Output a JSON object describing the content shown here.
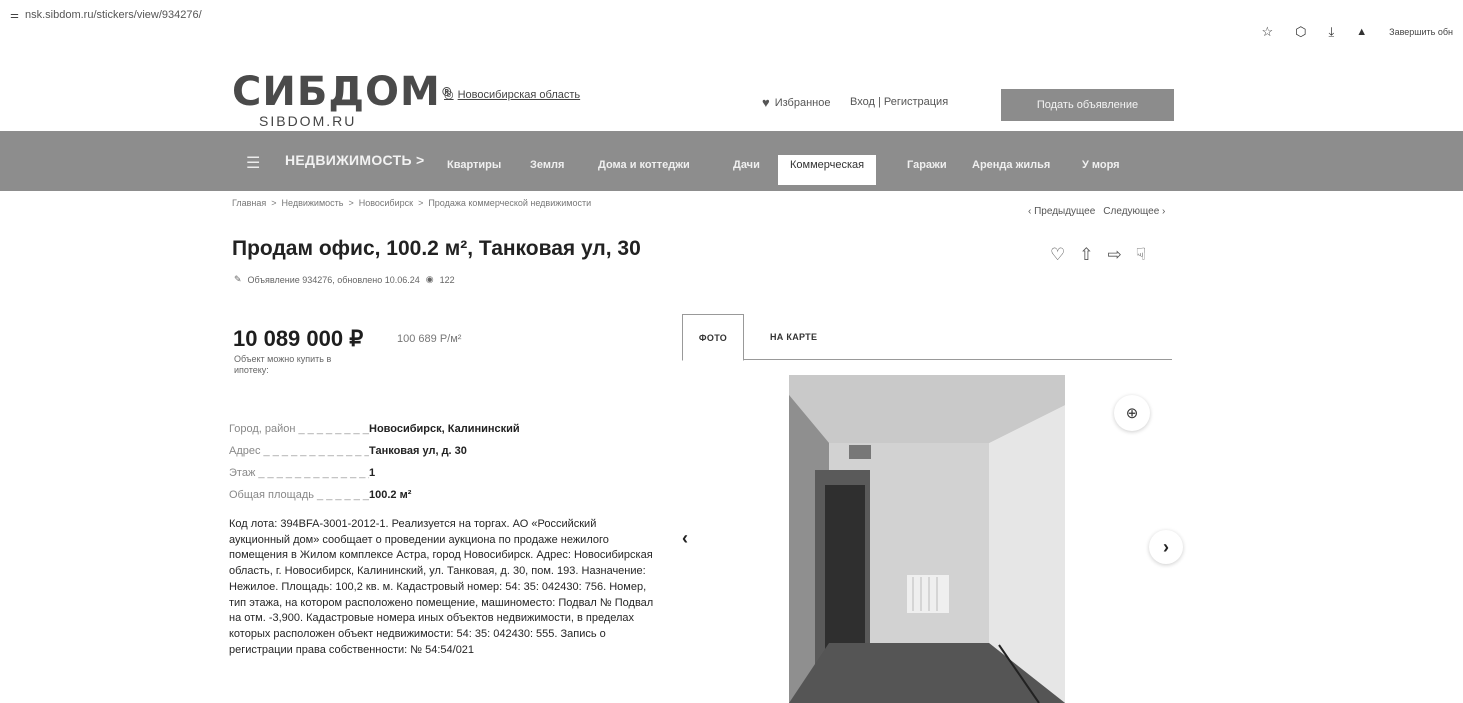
{
  "browser": {
    "url": "nsk.sibdom.ru/stickers/view/934276/",
    "star_icon": "☆",
    "extensions_icon": "⬡",
    "download_icon": "⤓",
    "profile_icon": "👤",
    "finish_setup": "Завершить обн"
  },
  "header": {
    "logo_main": "СИБДОМ",
    "logo_reg": "®",
    "logo_sub": "SIBDOM.RU",
    "region_icon": "◎",
    "region": "Новосибирская область",
    "favorites": "Избранное",
    "login": "Вход | Регистрация",
    "post_button": "Подать объявление"
  },
  "nav": {
    "title": "НЕДВИЖИМОСТЬ >",
    "items": [
      {
        "label": "Квартиры"
      },
      {
        "label": "Земля"
      },
      {
        "label": "Дома и коттеджи"
      },
      {
        "label": "Дачи"
      },
      {
        "label": "Коммерческая"
      },
      {
        "label": "Гаражи"
      },
      {
        "label": "Аренда жилья"
      },
      {
        "label": "У моря"
      }
    ],
    "active": "Коммерческая"
  },
  "breadcrumb": {
    "items": [
      "Главная",
      "Недвижимость",
      "Новосибирск",
      "Продажа коммерческой недвижимости"
    ],
    "separator": ">"
  },
  "pager": {
    "prev": "‹ Предыдущее",
    "next": "Следующее ›"
  },
  "listing": {
    "title": "Продам офис, 100.2 м², Танковая ул, 30",
    "meta": "Объявление 934276, обновлено 10.06.24",
    "views": "122",
    "price": "10 089 000 ₽",
    "price_per_sqm": "100 689 Р/м²",
    "mortgage": "Объект можно купить в ипотеку:",
    "params": [
      {
        "label": "Город, район",
        "value": "Новосибирск, Калининский"
      },
      {
        "label": "Адрес",
        "value": "Танковая ул, д. 30"
      },
      {
        "label": "Этаж",
        "value": "1"
      },
      {
        "label": "Общая площадь",
        "value": "100.2 м²"
      }
    ],
    "description": "Код лота: 394BFA-3001-2012-1. Реализуется на торгах. АО «Российский аукционный дом» сообщает о проведении аукциона по продаже нежилого помещения в Жилом комплексе Астра, город Новосибирск. Адрес: Новосибирская область, г. Новосибирск, Калининский, ул. Танковая, д. 30, пом. 193. Назначение: Нежилое. Площадь: 100,2 кв. м. Кадастровый номер: 54: 35: 042430: 756. Номер, тип этажа, на котором расположено помещение, машиноместо: Подвал № Подвал на отм. -3,900. Кадастровые номера иных объектов недвижимости, в пределах которых расположен объект недвижимости: 54: 35: 042430: 555. Запись о регистрации права собственности: № 54:54/021"
  },
  "gallery": {
    "tab_photo": "ФОТО",
    "tab_map": "НА КАРТЕ",
    "zoom_icon": "⊕",
    "prev_icon": "‹",
    "next_icon": "›"
  }
}
